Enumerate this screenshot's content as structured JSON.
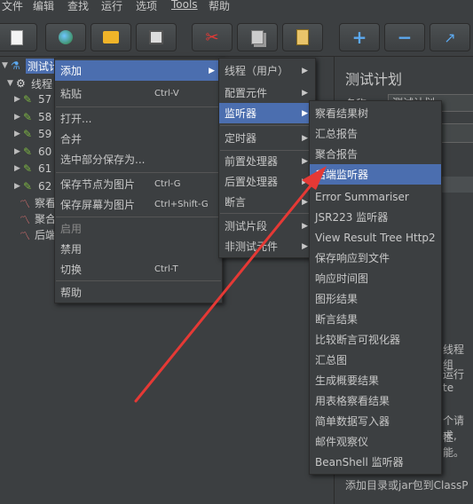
{
  "menubar": [
    "文件",
    "编辑",
    "查找",
    "运行",
    "选项",
    "Tools",
    "帮助"
  ],
  "toolbar": {
    "icons": [
      "new-icon",
      "templates-icon",
      "open-icon",
      "save-icon",
      "cut-icon",
      "copy-icon",
      "paste-icon",
      "expand-icon",
      "collapse-icon",
      "toggle-icon"
    ],
    "plus": "+",
    "minus": "−"
  },
  "tree": {
    "root": "测试计",
    "thread_group": "线程",
    "samplers": [
      "57",
      "58",
      "59",
      "60",
      "61",
      "62"
    ],
    "listeners": [
      "察看",
      "聚合",
      "后端"
    ]
  },
  "right_panel": {
    "title": "测试计划",
    "label_name": "名称:",
    "name_value": "测试计划",
    "text1": "线程组",
    "text2": "运行 te",
    "text3": "个请求,",
    "text4": "性能。",
    "bottom": "添加目录或jar包到ClassP"
  },
  "context_menu": {
    "items": [
      {
        "label": "添加",
        "shortcut": "",
        "submenu": true
      },
      {
        "label": "粘贴",
        "shortcut": "Ctrl-V"
      },
      {
        "label": "打开..."
      },
      {
        "label": "合并"
      },
      {
        "label": "选中部分保存为..."
      },
      {
        "label": "保存节点为图片",
        "shortcut": "Ctrl-G"
      },
      {
        "label": "保存屏幕为图片",
        "shortcut": "Ctrl+Shift-G"
      },
      {
        "label": "启用"
      },
      {
        "label": "禁用"
      },
      {
        "label": "切换",
        "shortcut": "Ctrl-T"
      },
      {
        "label": "帮助"
      }
    ]
  },
  "add_menu": {
    "items": [
      "线程（用户）",
      "配置元件",
      "监听器",
      "定时器",
      "前置处理器",
      "后置处理器",
      "断言",
      "测试片段",
      "非测试元件"
    ]
  },
  "listener_menu": {
    "items": [
      "察看结果树",
      "汇总报告",
      "聚合报告",
      "后端监听器",
      "Error Summariser",
      "JSR223 监听器",
      "View Result Tree Http2",
      "保存响应到文件",
      "响应时间图",
      "图形结果",
      "断言结果",
      "比较断言可视化器",
      "汇总图",
      "生成概要结果",
      "用表格察看结果",
      "简单数据写入器",
      "邮件观察仪",
      "BeanShell 监听器"
    ]
  },
  "colors": {
    "background": "#3c3f41",
    "highlight": "#4b6eaf",
    "arrow": "#e53935"
  }
}
